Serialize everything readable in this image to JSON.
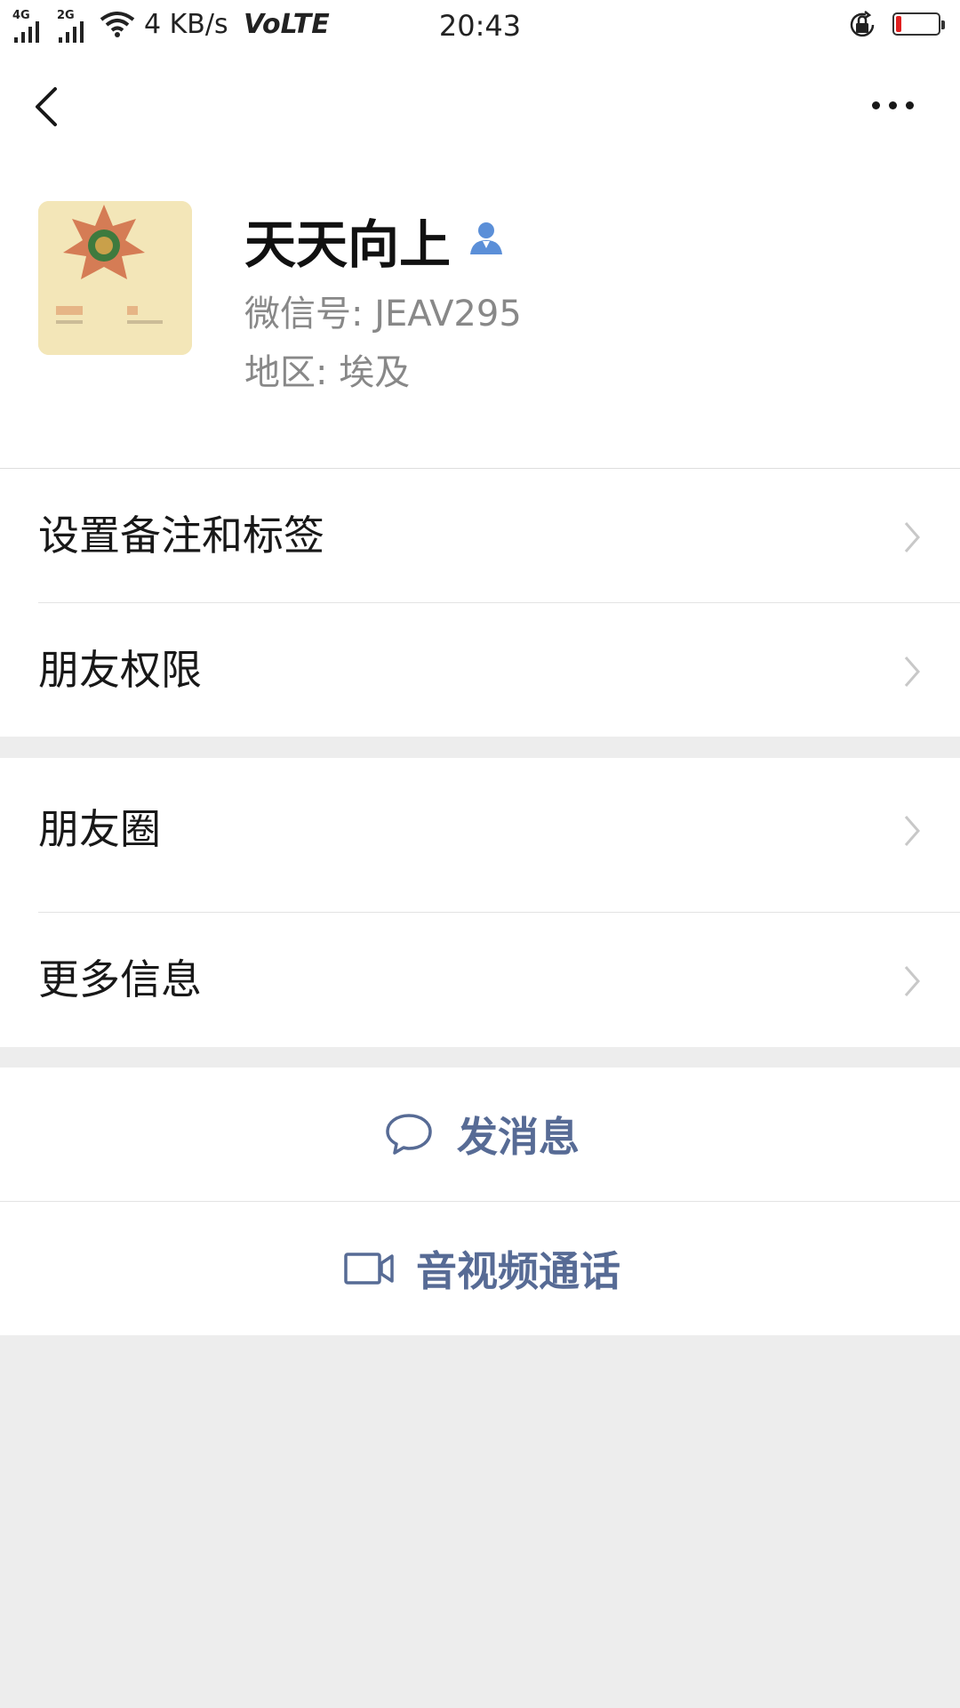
{
  "status_bar": {
    "signal1": "4G",
    "signal2": "2G",
    "speed": "4 KB/s",
    "network": "VoLTE",
    "time": "20:43",
    "battery_level": 0.12,
    "battery_color": "#e02020"
  },
  "nav": {
    "back_icon": "chevron-left-icon",
    "more_icon": "more-dots-icon"
  },
  "profile": {
    "name": "天天向上",
    "wechat_id": "微信号: JEAV295",
    "region": "地区: 埃及",
    "name_icon": "person-icon",
    "name_icon_color": "#5b8fd8"
  },
  "menu_group1": [
    {
      "label": "设置备注和标签"
    },
    {
      "label": "朋友权限"
    }
  ],
  "menu_group2": [
    {
      "label": "朋友圈"
    },
    {
      "label": "更多信息"
    }
  ],
  "actions": {
    "send_message": "发消息",
    "av_call": "音视频通话",
    "accent_color": "#576b95"
  }
}
